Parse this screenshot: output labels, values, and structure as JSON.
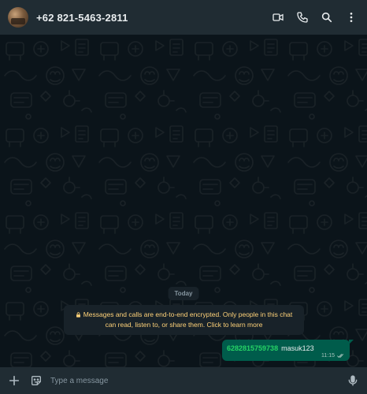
{
  "header": {
    "contact_name": "+62 821-5463-2811",
    "icons": [
      "video-call-icon",
      "voice-call-icon",
      "search-icon",
      "more-options-icon"
    ]
  },
  "chat": {
    "date_label": "Today",
    "encryption_notice": "Messages and calls are end-to-end encrypted. Only people in this chat can read, listen to, or share them. Click to learn more",
    "messages": [
      {
        "direction": "outgoing",
        "mention": "6282815759738",
        "text": "masuk123",
        "time": "11:15",
        "status": "read"
      }
    ]
  },
  "composer": {
    "placeholder": "Type a message",
    "icons": [
      "attach-plus-icon",
      "sticker-icon",
      "microphone-icon"
    ]
  },
  "colors": {
    "header_bg": "#202c33",
    "chat_bg": "#0b141a",
    "outgoing_bubble": "#005c4b",
    "mention": "#25d366",
    "notice_text": "#ffd279"
  }
}
